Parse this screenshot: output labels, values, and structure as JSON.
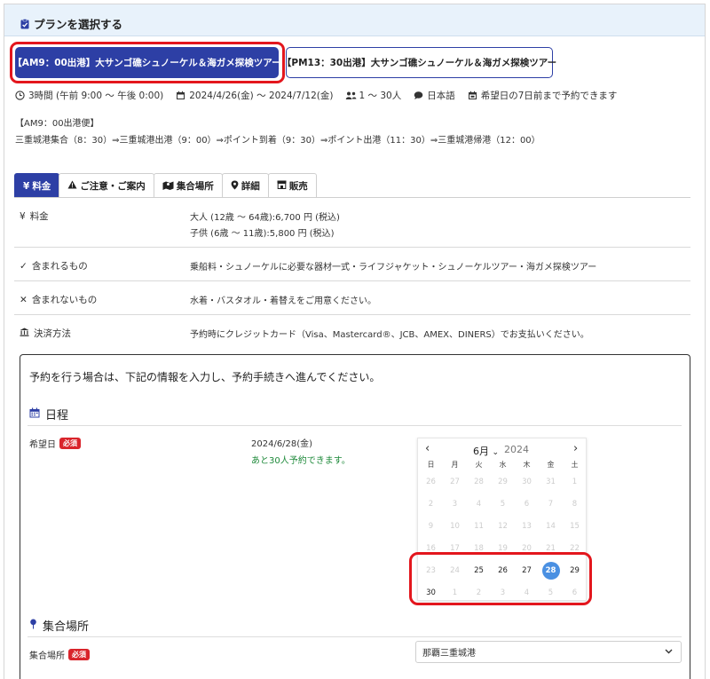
{
  "header": {
    "title": "プランを選択する"
  },
  "plans": [
    {
      "label": "【AM9：00出港】大サンゴ礁シュノーケル＆海ガメ探検ツアー",
      "selected": true
    },
    {
      "label": "【PM13：30出港】大サンゴ礁シュノーケル＆海ガメ探検ツアー",
      "selected": false
    }
  ],
  "meta": {
    "duration": "3時間 (午前 9:00 ～ 午後 0:00)",
    "period": "2024/4/26(金) ～ 2024/7/12(金)",
    "people": "1 ～ 30人",
    "language": "日本語",
    "booking": "希望日の7日前まで予約できます"
  },
  "description": {
    "line1": "【AM9：00出港便】",
    "line2": "三重城港集合（8：30）⇒三重城港出港（9：00）⇒ポイント到着（9：30）⇒ポイント出港（11：30）⇒三重城港帰港（12：00）"
  },
  "tabs": [
    {
      "label": "料金",
      "icon": "yen-icon"
    },
    {
      "label": "ご注意・ご案内",
      "icon": "warning-icon"
    },
    {
      "label": "集合場所",
      "icon": "map-icon"
    },
    {
      "label": "詳細",
      "icon": "pin-icon"
    },
    {
      "label": "販売",
      "icon": "store-icon"
    }
  ],
  "info": {
    "price_label": "料金",
    "price_adult": "大人 (12歳 ～ 64歳):6,700 円 (税込)",
    "price_child": "子供 (6歳 ～ 11歳):5,800 円 (税込)",
    "included_label": "含まれるもの",
    "included_value": "乗船料・シュノーケルに必要な器材一式・ライフジャケット・シュノーケルツアー・海ガメ探検ツアー",
    "excluded_label": "含まれないもの",
    "excluded_value": "水着・バスタオル・着替えをご用意ください。",
    "payment_label": "決済方法",
    "payment_value": "予約時にクレジットカード（Visa、Mastercard®、JCB、AMEX、DINERS）でお支払いください。"
  },
  "booking": {
    "intro": "予約を行う場合は、下記の情報を入力し、予約手続きへ進んでください。",
    "schedule_title": "日程",
    "date_label": "希望日",
    "required": "必須",
    "date_value": "2024/6/28(金)",
    "availability": "あと30人予約できます。",
    "meeting_title": "集合場所",
    "meeting_label": "集合場所",
    "meeting_value": "那覇三重城港"
  },
  "calendar": {
    "month": "6月",
    "year": "2024",
    "weekdays": [
      "日",
      "月",
      "火",
      "水",
      "木",
      "金",
      "土"
    ],
    "weeks": [
      [
        "26",
        "27",
        "28",
        "29",
        "30",
        "31",
        "1"
      ],
      [
        "2",
        "3",
        "4",
        "5",
        "6",
        "7",
        "8"
      ],
      [
        "9",
        "10",
        "11",
        "12",
        "13",
        "14",
        "15"
      ],
      [
        "16",
        "17",
        "18",
        "19",
        "20",
        "21",
        "22"
      ],
      [
        "23",
        "24",
        "25",
        "26",
        "27",
        "28",
        "29"
      ],
      [
        "30",
        "1",
        "2",
        "3",
        "4",
        "5",
        "6"
      ]
    ],
    "enabled": [
      "25",
      "26",
      "27",
      "28",
      "30"
    ],
    "selected": "28"
  }
}
